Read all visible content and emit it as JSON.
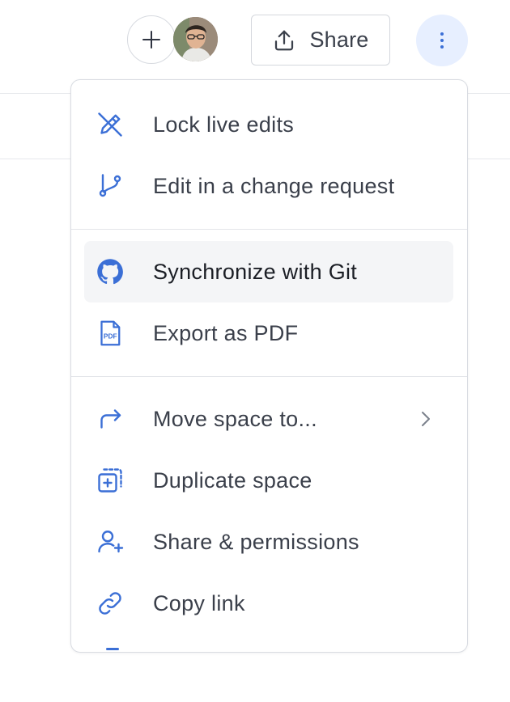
{
  "header": {
    "add_button": "add",
    "share_label": "Share",
    "more_button": "more-options"
  },
  "menu": {
    "items": [
      {
        "label": "Lock live edits",
        "icon": "pencil-slash-icon"
      },
      {
        "label": "Edit in a change request",
        "icon": "git-branch-icon"
      },
      {
        "label": "Synchronize with Git",
        "icon": "github-icon"
      },
      {
        "label": "Export as PDF",
        "icon": "pdf-file-icon"
      },
      {
        "label": "Move space to...",
        "icon": "arrow-turn-right-icon"
      },
      {
        "label": "Duplicate space",
        "icon": "duplicate-icon"
      },
      {
        "label": "Share & permissions",
        "icon": "user-plus-icon"
      },
      {
        "label": "Copy link",
        "icon": "link-icon"
      }
    ]
  },
  "colors": {
    "icon_blue": "#3b6fd6",
    "more_bg": "#e7efff",
    "hover_bg": "#f4f5f7"
  }
}
